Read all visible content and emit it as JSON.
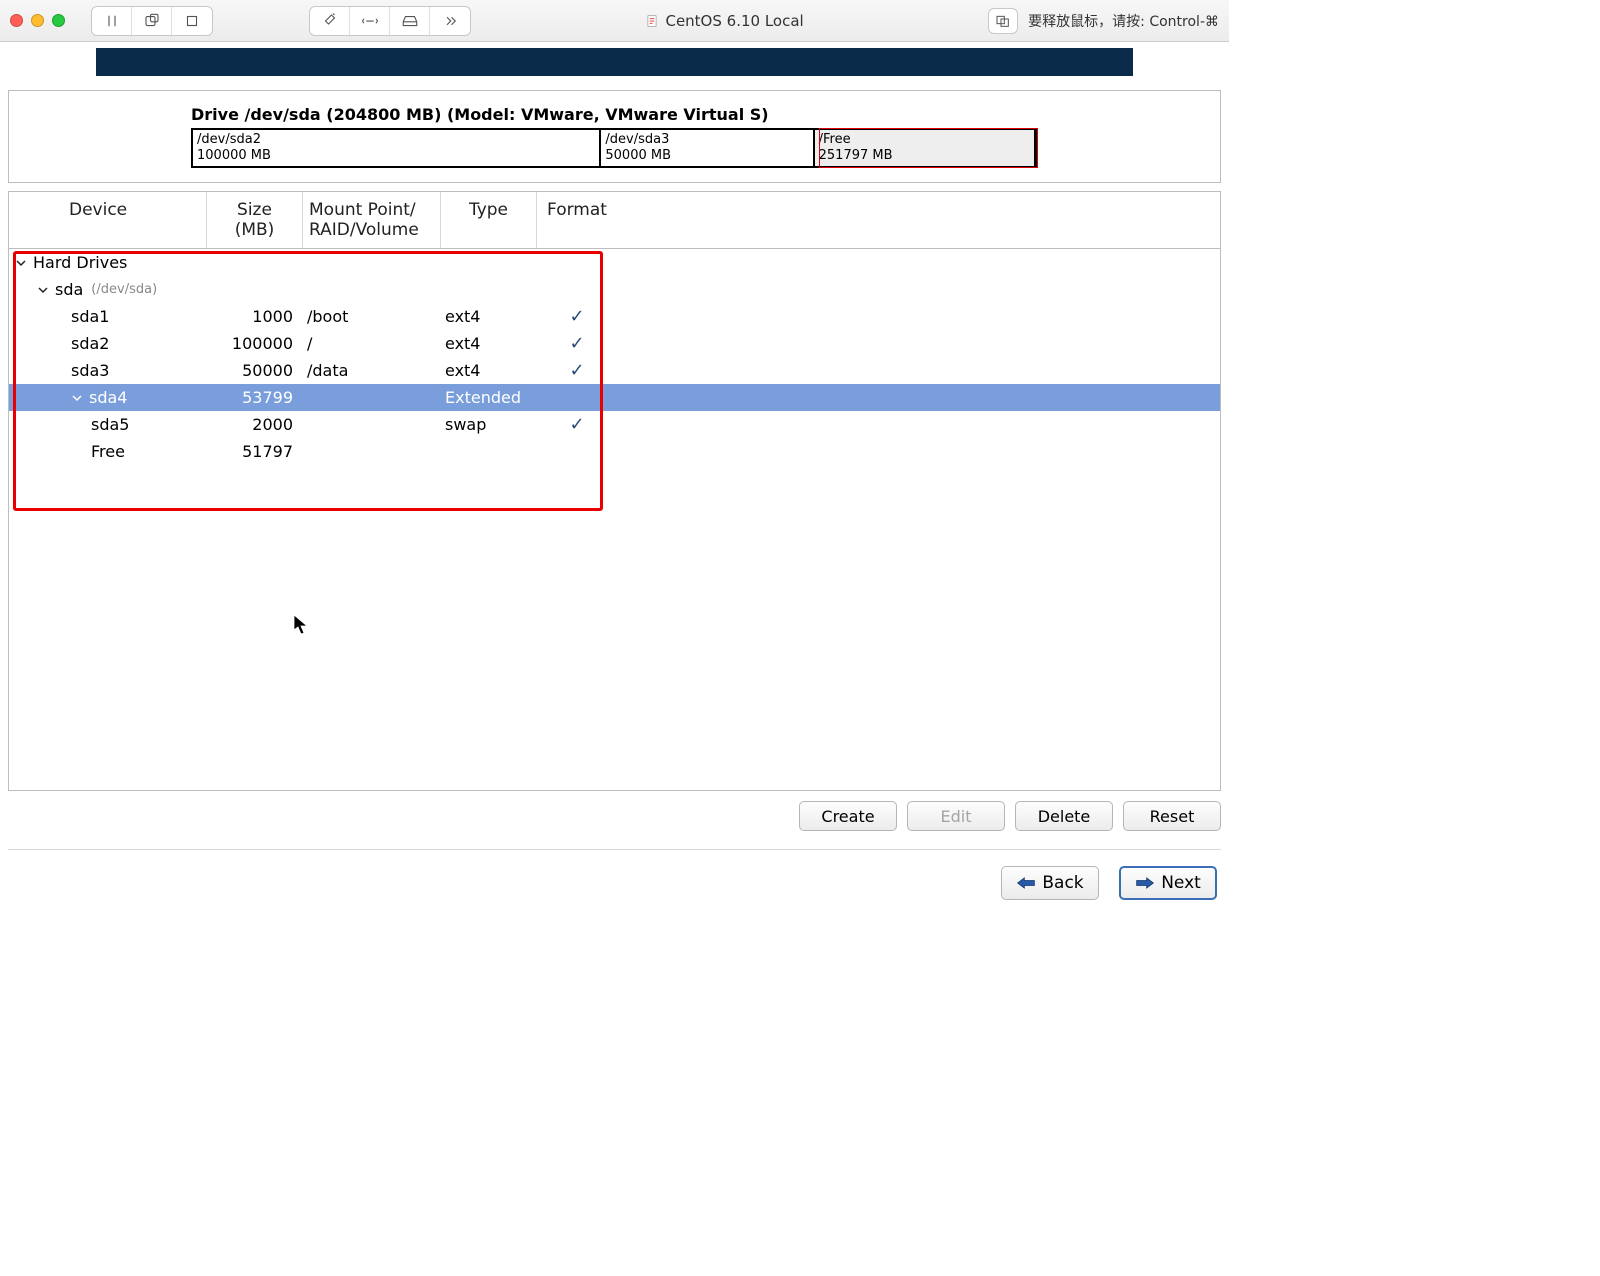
{
  "titlebar": {
    "vm_name": "CentOS 6.10 Local",
    "hint_text": "要释放鼠标，请按: Control-⌘"
  },
  "drive": {
    "label": "Drive /dev/sda (204800 MB) (Model: VMware, VMware Virtual S)",
    "blocks": [
      {
        "name": "/dev/sda2",
        "size": "100000 MB",
        "flex": 49,
        "free": false
      },
      {
        "name": "/dev/sda3",
        "size": "50000 MB",
        "flex": 25,
        "free": false
      },
      {
        "name": "/Free",
        "size": "251797 MB",
        "flex": 26,
        "free": true
      }
    ]
  },
  "columns": {
    "device": "Device",
    "size_line1": "Size",
    "size_line2": "(MB)",
    "mnt_line1": "Mount Point/",
    "mnt_line2": "RAID/Volume",
    "type": "Type",
    "format": "Format"
  },
  "tree": {
    "root_label": "Hard Drives",
    "disk_label": "sda",
    "disk_path": "(/dev/sda)",
    "rows": [
      {
        "dev": "sda1",
        "size": "1000",
        "mnt": "/boot",
        "type": "ext4",
        "fmt": true,
        "indent": 2,
        "selected": false,
        "expand": false
      },
      {
        "dev": "sda2",
        "size": "100000",
        "mnt": "/",
        "type": "ext4",
        "fmt": true,
        "indent": 2,
        "selected": false,
        "expand": false
      },
      {
        "dev": "sda3",
        "size": "50000",
        "mnt": "/data",
        "type": "ext4",
        "fmt": true,
        "indent": 2,
        "selected": false,
        "expand": false
      },
      {
        "dev": "sda4",
        "size": "53799",
        "mnt": "",
        "type": "Extended",
        "fmt": false,
        "indent": 2,
        "selected": true,
        "expand": true
      },
      {
        "dev": "sda5",
        "size": "2000",
        "mnt": "",
        "type": "swap",
        "fmt": true,
        "indent": 3,
        "selected": false,
        "expand": false
      },
      {
        "dev": "Free",
        "size": "51797",
        "mnt": "",
        "type": "",
        "fmt": false,
        "indent": 3,
        "selected": false,
        "expand": false
      }
    ]
  },
  "buttons": {
    "create": "Create",
    "edit": "Edit",
    "delete": "Delete",
    "reset": "Reset",
    "back": "Back",
    "next": "Next"
  }
}
